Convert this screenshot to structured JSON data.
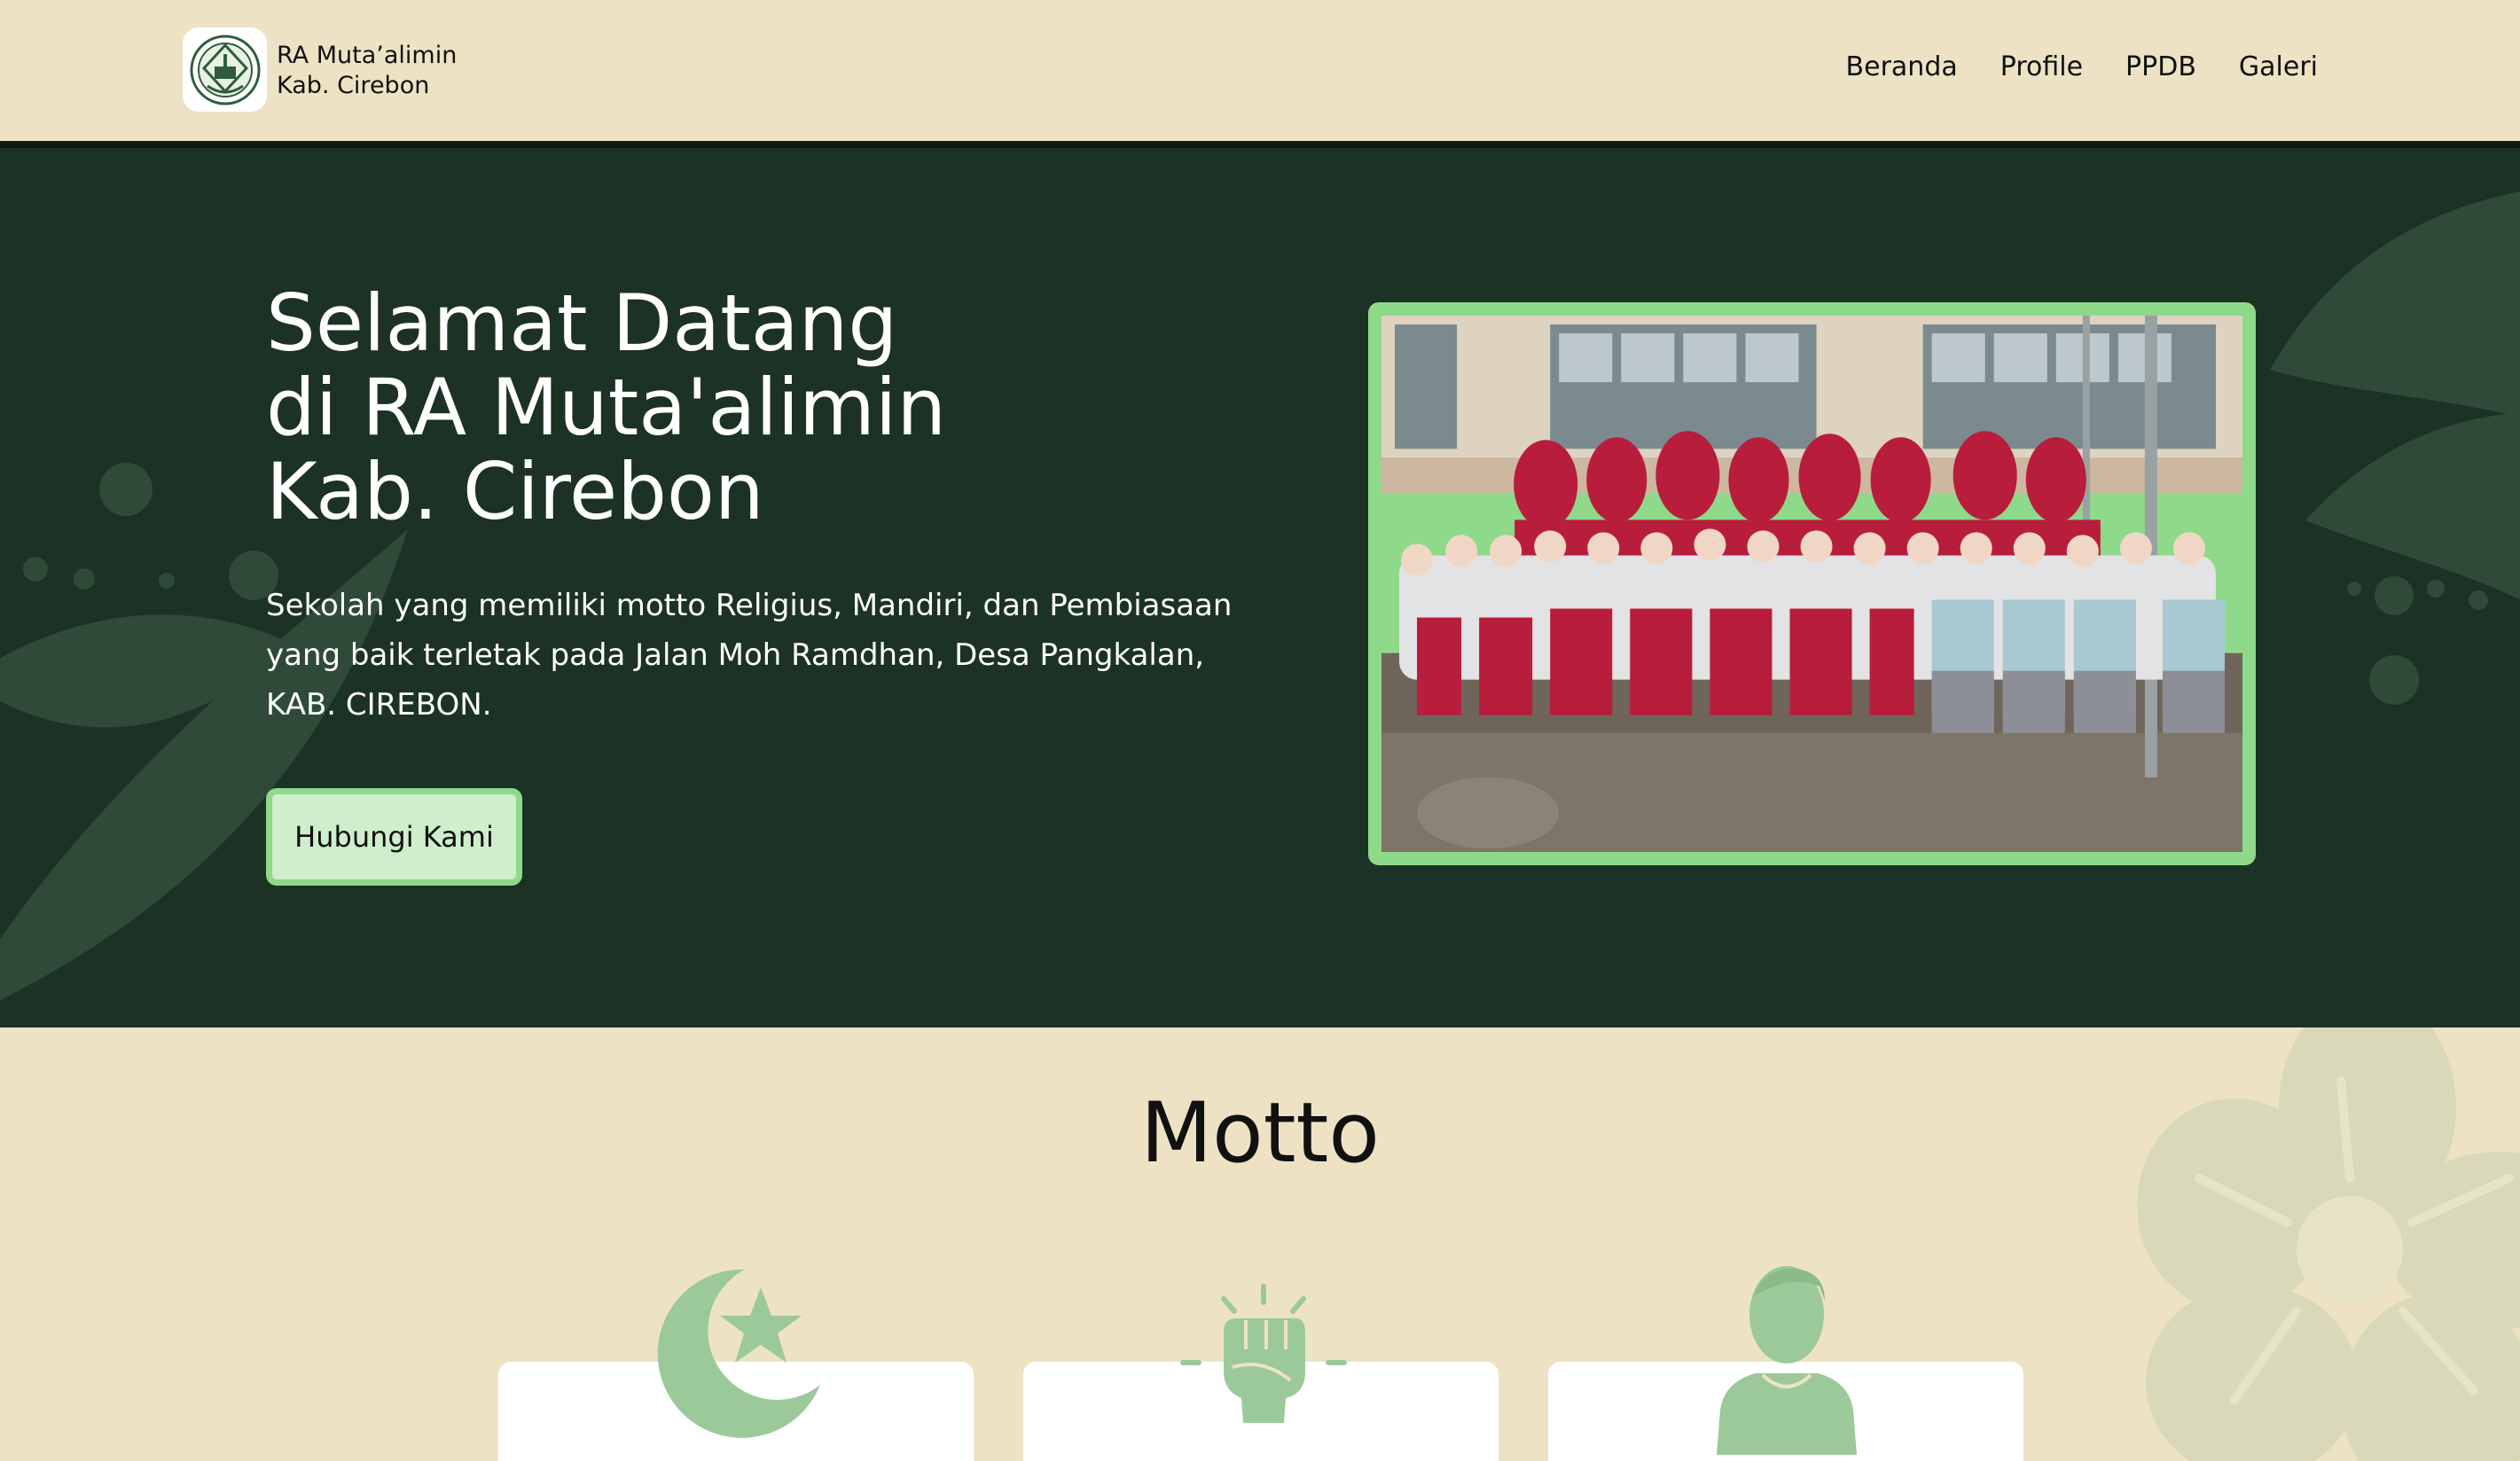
{
  "header": {
    "logo_line1": "RA Muta’alimin",
    "logo_line2": "Kab. Cirebon",
    "nav": [
      "Beranda",
      "Profile",
      "PPDB",
      "Galeri"
    ]
  },
  "hero": {
    "title_line1": "Selamat Datang",
    "title_line2": "di RA Muta'alimin",
    "title_line3": "Kab. Cirebon",
    "description": "Sekolah yang memiliki motto Religius, Mandiri, dan Pembiasaan yang baik terletak pada Jalan Moh Ramdhan, Desa Pangkalan, KAB. CIREBON.",
    "cta_label": "Hubungi Kami"
  },
  "motto": {
    "title": "Motto",
    "icons": [
      "crescent-star-icon",
      "raised-fist-icon",
      "person-icon"
    ]
  },
  "colors": {
    "header_bg": "#ede3c4",
    "hero_bg": "#1c3224",
    "accent_green": "#8fd98a",
    "button_bg": "#cfeecb",
    "icon_green": "#9cc99a"
  }
}
